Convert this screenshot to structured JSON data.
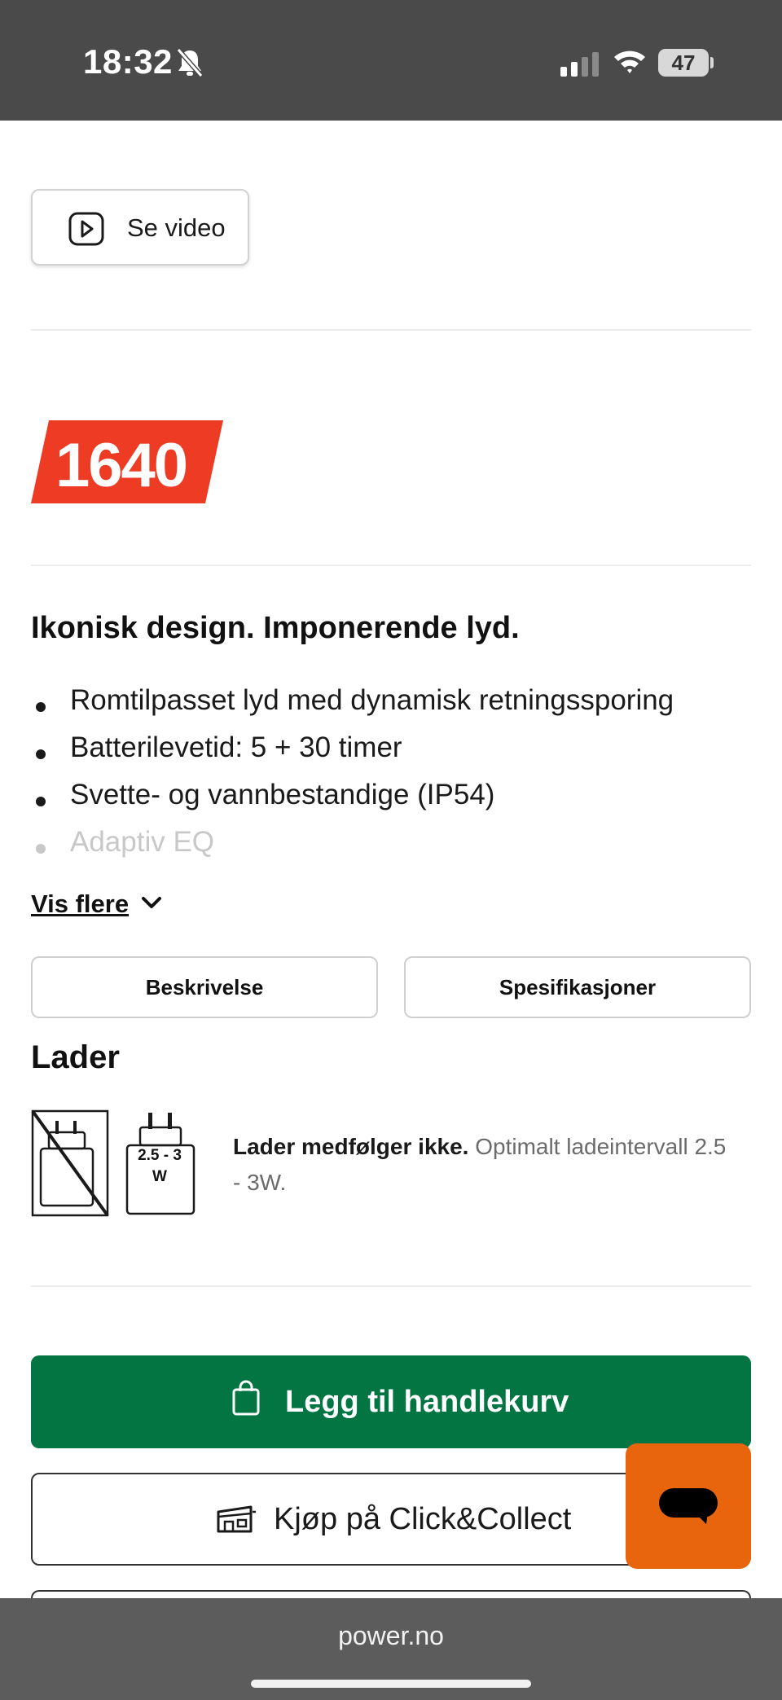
{
  "status_bar": {
    "time": "18:32",
    "battery": "47",
    "icons": [
      "bell-muted-icon",
      "signal-icon",
      "wifi-icon",
      "battery-icon"
    ]
  },
  "video": {
    "label": "Se video",
    "icon": "play-icon"
  },
  "price": {
    "value": "1640",
    "color": "#ee3b24"
  },
  "product": {
    "headline": "Ikonisk design. Imponerende lyd.",
    "features": [
      "Romtilpasset lyd med dynamisk retningssporing",
      "Batterilevetid: 5 + 30 timer",
      "Svette- og vannbestandige (IP54)",
      "Adaptiv EQ"
    ],
    "show_more": "Vis flere"
  },
  "tabs": {
    "description": "Beskrivelse",
    "specifications": "Spesifikasjoner"
  },
  "charger": {
    "heading": "Lader",
    "icon_label_top": "2.5 - 3",
    "icon_label_bottom": "W",
    "text_bold": "Lader medfølger ikke.",
    "text_rest": " Optimalt ladeintervall 2.5 - 3W."
  },
  "actions": {
    "add_to_cart": "Legg til handlekurv",
    "click_collect": "Kjøp på Click&Collect",
    "primary_color": "#027542",
    "chat_color": "#e8650e"
  },
  "browser": {
    "url": "power.no"
  }
}
